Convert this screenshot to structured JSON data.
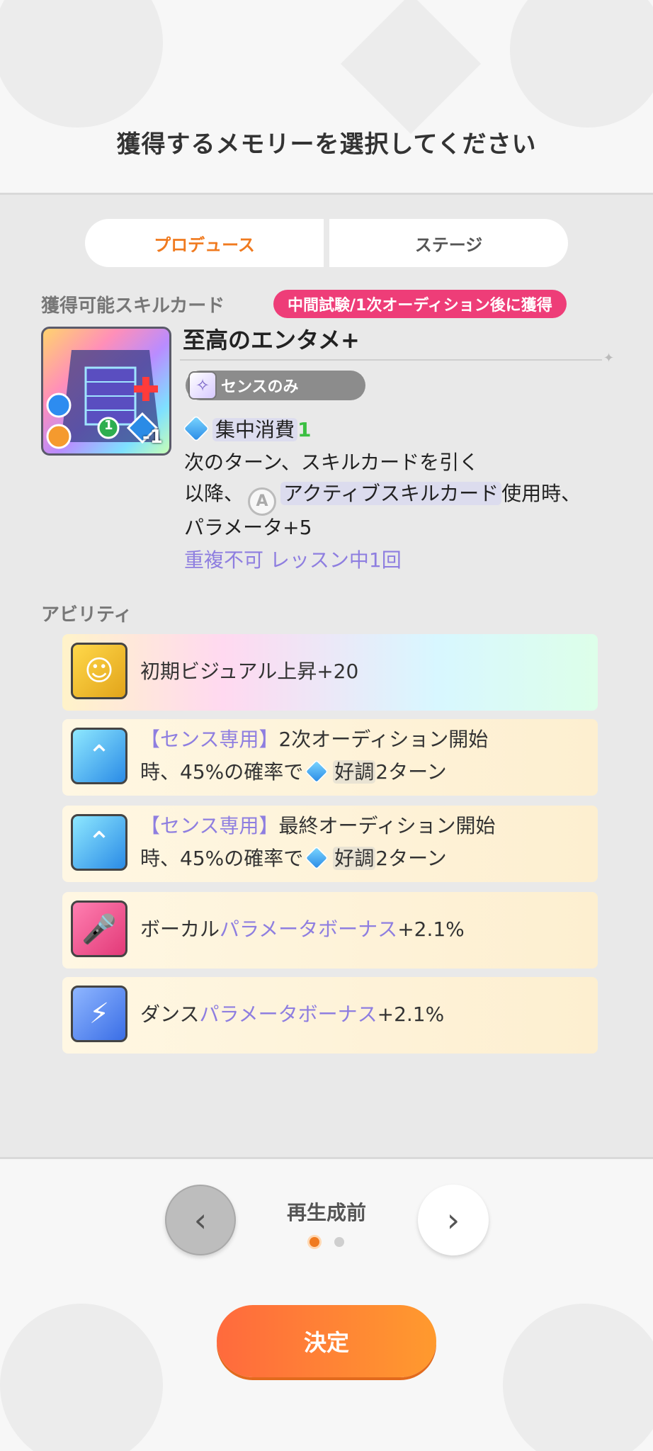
{
  "header": {
    "title": "獲得するメモリーを選択してください"
  },
  "tabs": [
    {
      "label": "プロデュース",
      "active": true
    },
    {
      "label": "ステージ",
      "active": false
    }
  ],
  "skill_section": {
    "label": "獲得可能スキルカード",
    "badge": "中間試験/1次オーディション後に獲得",
    "card": {
      "name": "至高のエンタメ+",
      "plan_badge": "センスのみ",
      "art_cost": "-1",
      "art_level": "1",
      "effect_line1_label": "集中消費",
      "effect_line1_value": "1",
      "effect_line2": "次のターン、スキルカードを引く",
      "effect_line3_pre": "以降、",
      "effect_line3_icon": "A",
      "effect_line3_hl": "アクティブスキルカード",
      "effect_line3_post": "使用時、",
      "effect_line4": "パラメータ+5",
      "effect_line5": "重複不可 レッスン中1回"
    }
  },
  "ability_section": {
    "label": "アビリティ",
    "items": [
      {
        "icon": "visual-up-icon",
        "text": "初期ビジュアル上昇+20"
      },
      {
        "icon": "sense-icon",
        "tag": "【センス専用】",
        "line1": "2次オーディション開始",
        "line2_pre": "時、45%の確率で",
        "line2_hl": "好調",
        "line2_post": "2ターン"
      },
      {
        "icon": "sense-icon",
        "tag": "【センス専用】",
        "line1": "最終オーディション開始",
        "line2_pre": "時、45%の確率で",
        "line2_hl": "好調",
        "line2_post": "2ターン"
      },
      {
        "icon": "mic-icon",
        "pre": "ボーカル",
        "accent": "パラメータボーナス",
        "post": "+2.1%"
      },
      {
        "icon": "dance-icon",
        "pre": "ダンス",
        "accent": "パラメータボーナス",
        "post": "+2.1%"
      }
    ]
  },
  "footer": {
    "page_label": "再生成前",
    "confirm_label": "決定",
    "prev_glyph": "‹",
    "next_glyph": "›"
  },
  "colors": {
    "accent_orange": "#f07a1f",
    "badge_pink": "#ee3d78",
    "accent_purple": "#8e7ee0",
    "green": "#3bbf42"
  }
}
